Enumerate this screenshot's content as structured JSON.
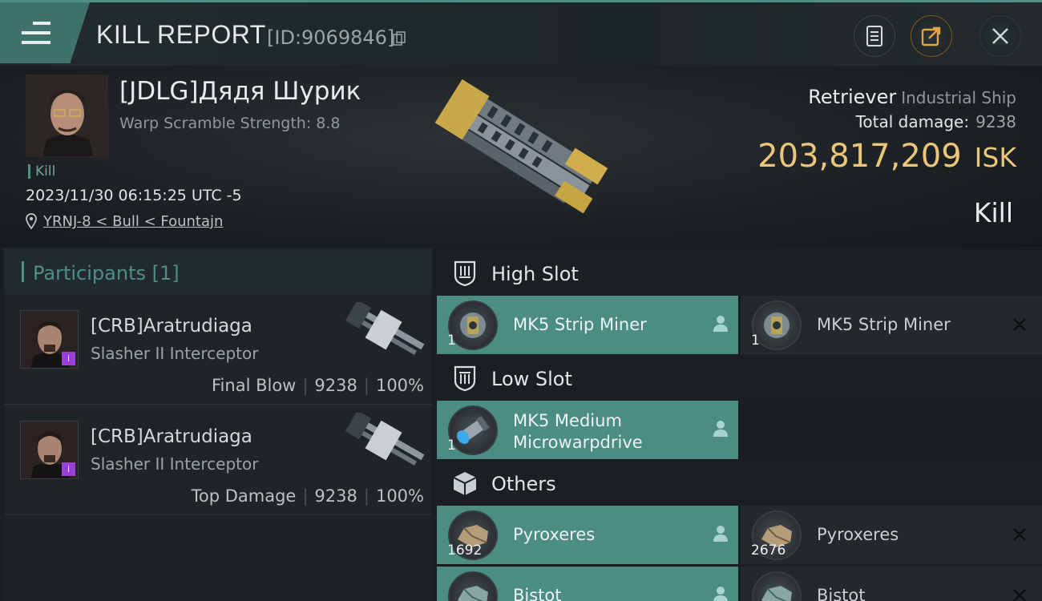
{
  "topbar": {
    "title": "KILL REPORT",
    "report_id": "[ID:9069846]"
  },
  "victim": {
    "name": "[JDLG]Дядя Шурик",
    "warp_strength": "Warp Scramble Strength: 8.8",
    "kill_tag": "Kill",
    "datetime": "2023/11/30 06:15:25 UTC -5",
    "location": "YRNJ-8 < Bull < Fountajn",
    "ship_name": "Retriever",
    "ship_class": "Industrial Ship",
    "total_damage_label": "Total damage:",
    "total_damage_value": "9238",
    "isk_value": "203,817,209",
    "isk_unit": "ISK",
    "result": "Kill"
  },
  "participants": {
    "title": "Participants [1]",
    "rows": [
      {
        "name": "[CRB]Aratrudiaga",
        "ship": "Slasher II Interceptor",
        "role": "Final Blow",
        "damage": "9238",
        "percent": "100%"
      },
      {
        "name": "[CRB]Aratrudiaga",
        "ship": "Slasher II Interceptor",
        "role": "Top Damage",
        "damage": "9238",
        "percent": "100%"
      }
    ]
  },
  "fitting": {
    "high_slot": {
      "title": "High Slot",
      "items": [
        {
          "name": "MK5 Strip Miner",
          "qty": "1",
          "state": "dropped"
        },
        {
          "name": "MK5 Strip Miner",
          "qty": "1",
          "state": "destroyed"
        }
      ]
    },
    "low_slot": {
      "title": "Low Slot",
      "items": [
        {
          "name_line1": "MK5 Medium",
          "name_line2": "Microwarpdrive",
          "qty": "1",
          "state": "dropped"
        }
      ]
    },
    "others": {
      "title": "Others",
      "items": [
        {
          "name": "Pyroxeres",
          "qty": "1692",
          "state": "dropped"
        },
        {
          "name": "Pyroxeres",
          "qty": "2676",
          "state": "destroyed"
        },
        {
          "name": "Bistot",
          "qty": "",
          "state": "dropped"
        },
        {
          "name": "Bistot",
          "qty": "",
          "state": "destroyed"
        }
      ]
    }
  },
  "colors": {
    "accent_teal": "#4b8c83",
    "isk_gold": "#e9c67a",
    "badge_purple": "#9a3fd6"
  },
  "icons": [
    "menu-icon",
    "copy-icon",
    "clipboard-icon",
    "share-icon",
    "close-icon",
    "location-pin-icon",
    "high-slot-icon",
    "low-slot-icon",
    "cargo-box-icon",
    "person-icon",
    "x-icon"
  ]
}
